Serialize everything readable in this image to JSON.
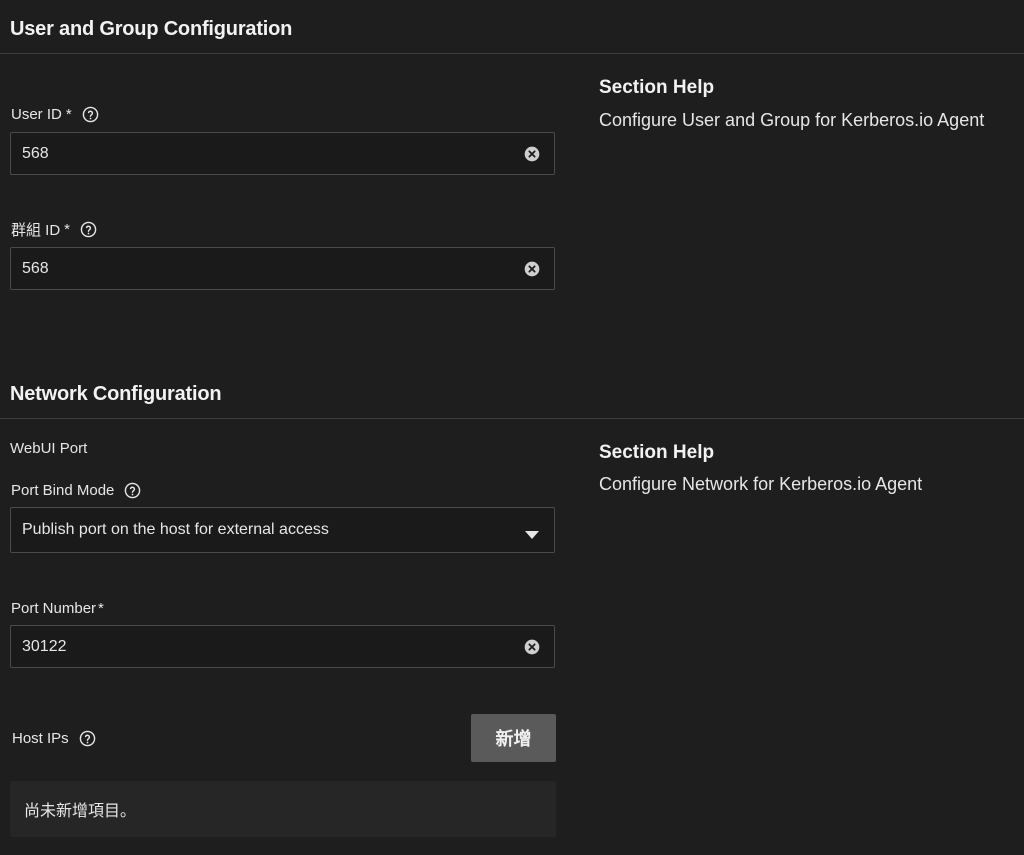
{
  "user_group": {
    "title": "User and Group Configuration",
    "help_title": "Section Help",
    "help_text": "Configure User and Group for Kerberos.io Agent",
    "user_id": {
      "label": "User ID",
      "required_mark": "*",
      "value": "568"
    },
    "group_id": {
      "label": "群組 ID",
      "required_mark": "*",
      "value": "568"
    }
  },
  "network": {
    "title": "Network Configuration",
    "help_title": "Section Help",
    "help_text": "Configure Network for Kerberos.io Agent",
    "webui_port_label": "WebUI Port",
    "port_bind_mode": {
      "label": "Port Bind Mode",
      "selected": "Publish port on the host for external access"
    },
    "port_number": {
      "label": "Port Number",
      "required_mark": "*",
      "value": "30122"
    },
    "host_ips": {
      "label": "Host IPs",
      "add_label": "新增",
      "empty_text": "尚未新增項目。"
    }
  },
  "icons": {
    "help": "help-circle-icon",
    "clear": "close-circle-icon",
    "dropdown": "caret-down-icon"
  },
  "colors": {
    "background": "#1e1e1e",
    "text": "#e6e6e6",
    "border": "#4a4a4a",
    "button": "#5a5a5a"
  }
}
